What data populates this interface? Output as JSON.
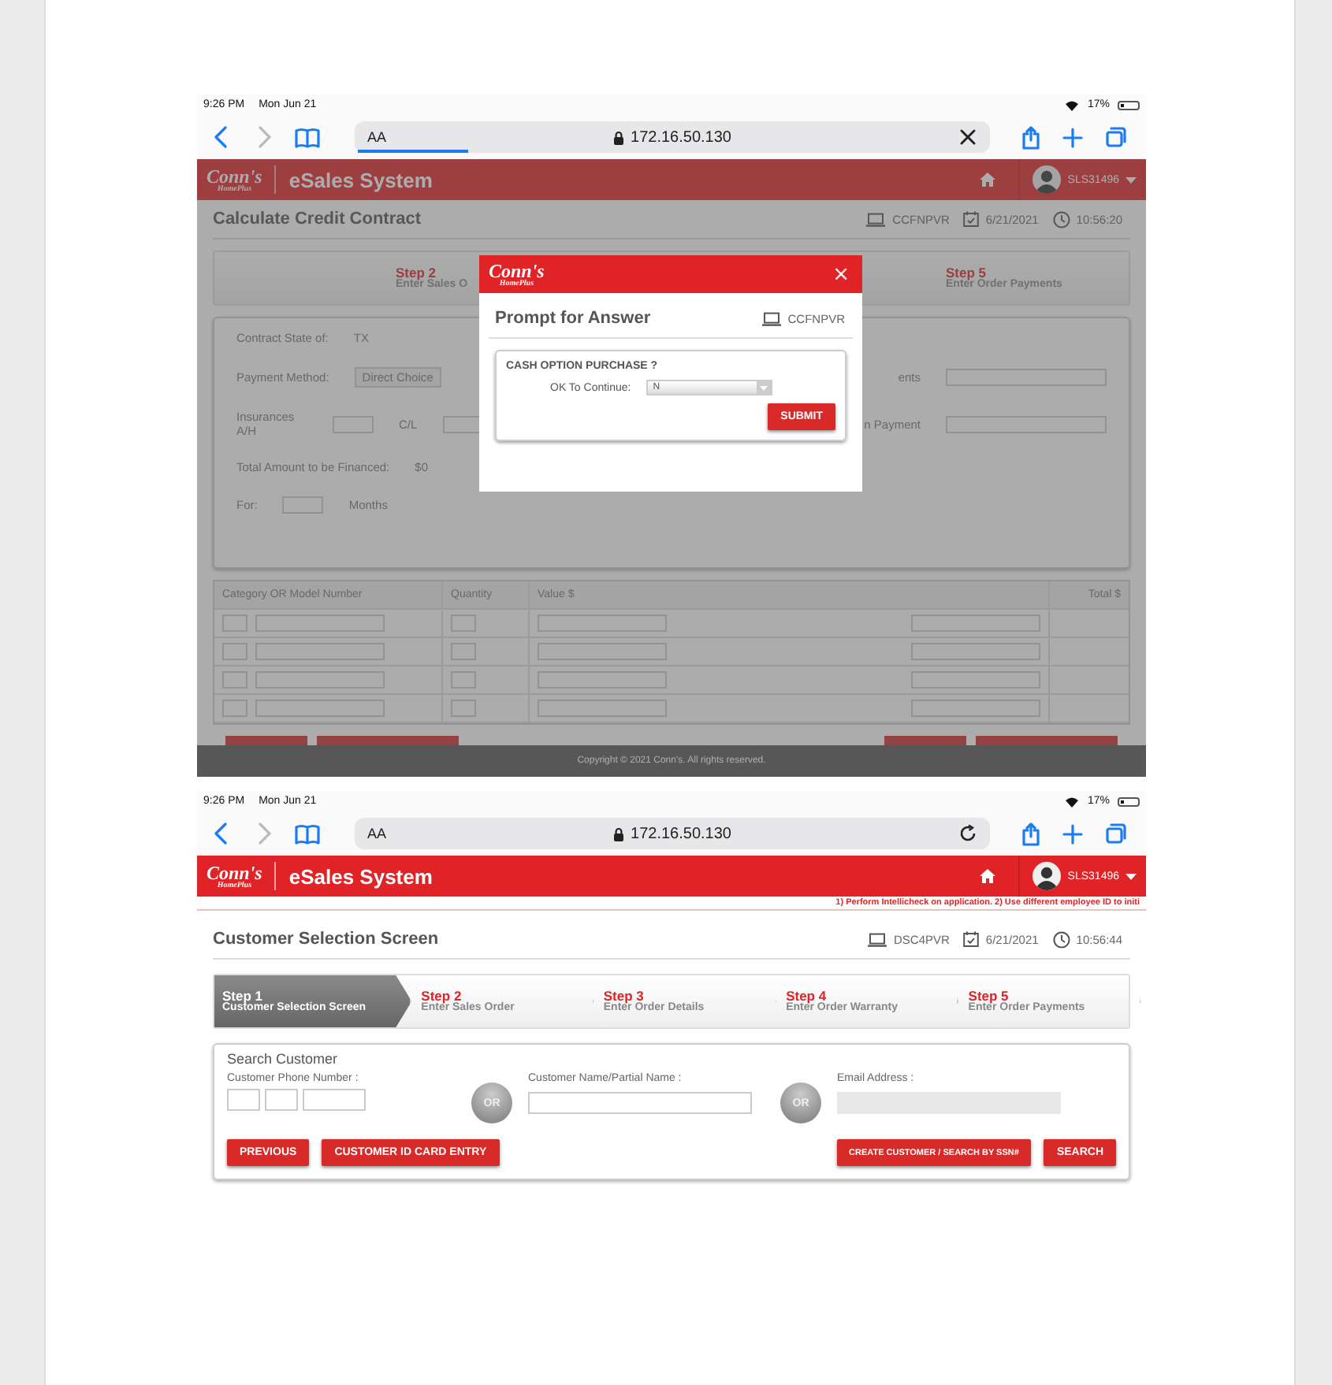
{
  "first_screen": {
    "status_bar": {
      "time": "9:26 PM",
      "date": "Mon Jun 21",
      "battery": "17%"
    },
    "browser": {
      "text_size": "AA",
      "url": "172.16.50.130",
      "field_action": {
        "kind": "close"
      },
      "focused": true
    },
    "app_header": {
      "logo": "Conn's",
      "logo_sub": "HomePlus",
      "title": "eSales System",
      "user": "SLS31496"
    },
    "page": {
      "title": "Calculate Credit Contract",
      "terminal": "CCFNPVR",
      "date": "6/21/2021",
      "time": "10:56:20"
    },
    "steps": [
      {
        "step": "Step 2",
        "label": "Enter Sales O",
        "selected": false
      },
      {
        "step": "Step 5",
        "label": "Enter Order Payments",
        "selected": false
      }
    ],
    "form": {
      "contract_state_label": "Contract State of:",
      "contract_state": "TX",
      "payment_label": "Payment Method:",
      "payment_value": "Direct Choice",
      "insurance_label": "Insurances A/H",
      "cl_label": "C/L",
      "right_label_1": "ents",
      "right_label_2": "n Payment",
      "total_label": "Total Amount to be Financed:",
      "total_value": "$0",
      "for_label": "For:",
      "months_label": "Months"
    },
    "table": {
      "columns": [
        "Category OR Model Number",
        "Quantity",
        "Value $",
        "Total $"
      ]
    },
    "footer": "Copyright © 2021 Conn's. All rights reserved.",
    "dialog": {
      "logo": "Conn's",
      "logo_sub": "HomePlus",
      "close": "×",
      "title": "Prompt for Answer",
      "terminal": "CCFNPVR",
      "question": "CASH OPTION PURCHASE ?",
      "field_label": "OK To Continue:",
      "value": "N",
      "button": "SUBMIT"
    }
  },
  "second_screen": {
    "status_bar": {
      "time": "9:26 PM",
      "date": "Mon Jun 21",
      "battery": "17%"
    },
    "browser": {
      "text_size": "AA",
      "url": "172.16.50.130",
      "field_action": {
        "kind": "reload"
      },
      "focused": false
    },
    "app_header": {
      "logo": "Conn's",
      "logo_sub": "HomePlus",
      "title": "eSales System",
      "user": "SLS31496"
    },
    "notice": "1) Perform Intellicheck on application. 2) Use different employee ID to initi",
    "page": {
      "title": "Customer Selection Screen",
      "terminal": "DSC4PVR",
      "date": "6/21/2021",
      "time": "10:56:44"
    },
    "steps": [
      {
        "step": "Step 1",
        "label": "Customer Selection Screen",
        "selected": true
      },
      {
        "step": "Step 2",
        "label": "Enter Sales Order",
        "selected": false
      },
      {
        "step": "Step 3",
        "label": "Enter Order Details",
        "selected": false
      },
      {
        "step": "Step 4",
        "label": "Enter Order Warranty",
        "selected": false
      },
      {
        "step": "Step 5",
        "label": "Enter Order Payments",
        "selected": false
      }
    ],
    "search": {
      "title": "Search Customer",
      "fields": [
        {
          "kind": "phone",
          "label": "Customer Phone Number :",
          "disabled": false
        },
        {
          "kind": "or",
          "label": "OR"
        },
        {
          "kind": "text",
          "label": "Customer Name/Partial Name :",
          "disabled": false
        },
        {
          "kind": "or",
          "label": "OR"
        },
        {
          "kind": "text",
          "label": "Email Address :",
          "disabled": true
        }
      ],
      "left_buttons": [
        "PREVIOUS",
        "CUSTOMER ID CARD ENTRY"
      ],
      "right_buttons": [
        "CREATE CUSTOMER / SEARCH BY SSN#",
        "SEARCH"
      ]
    }
  }
}
